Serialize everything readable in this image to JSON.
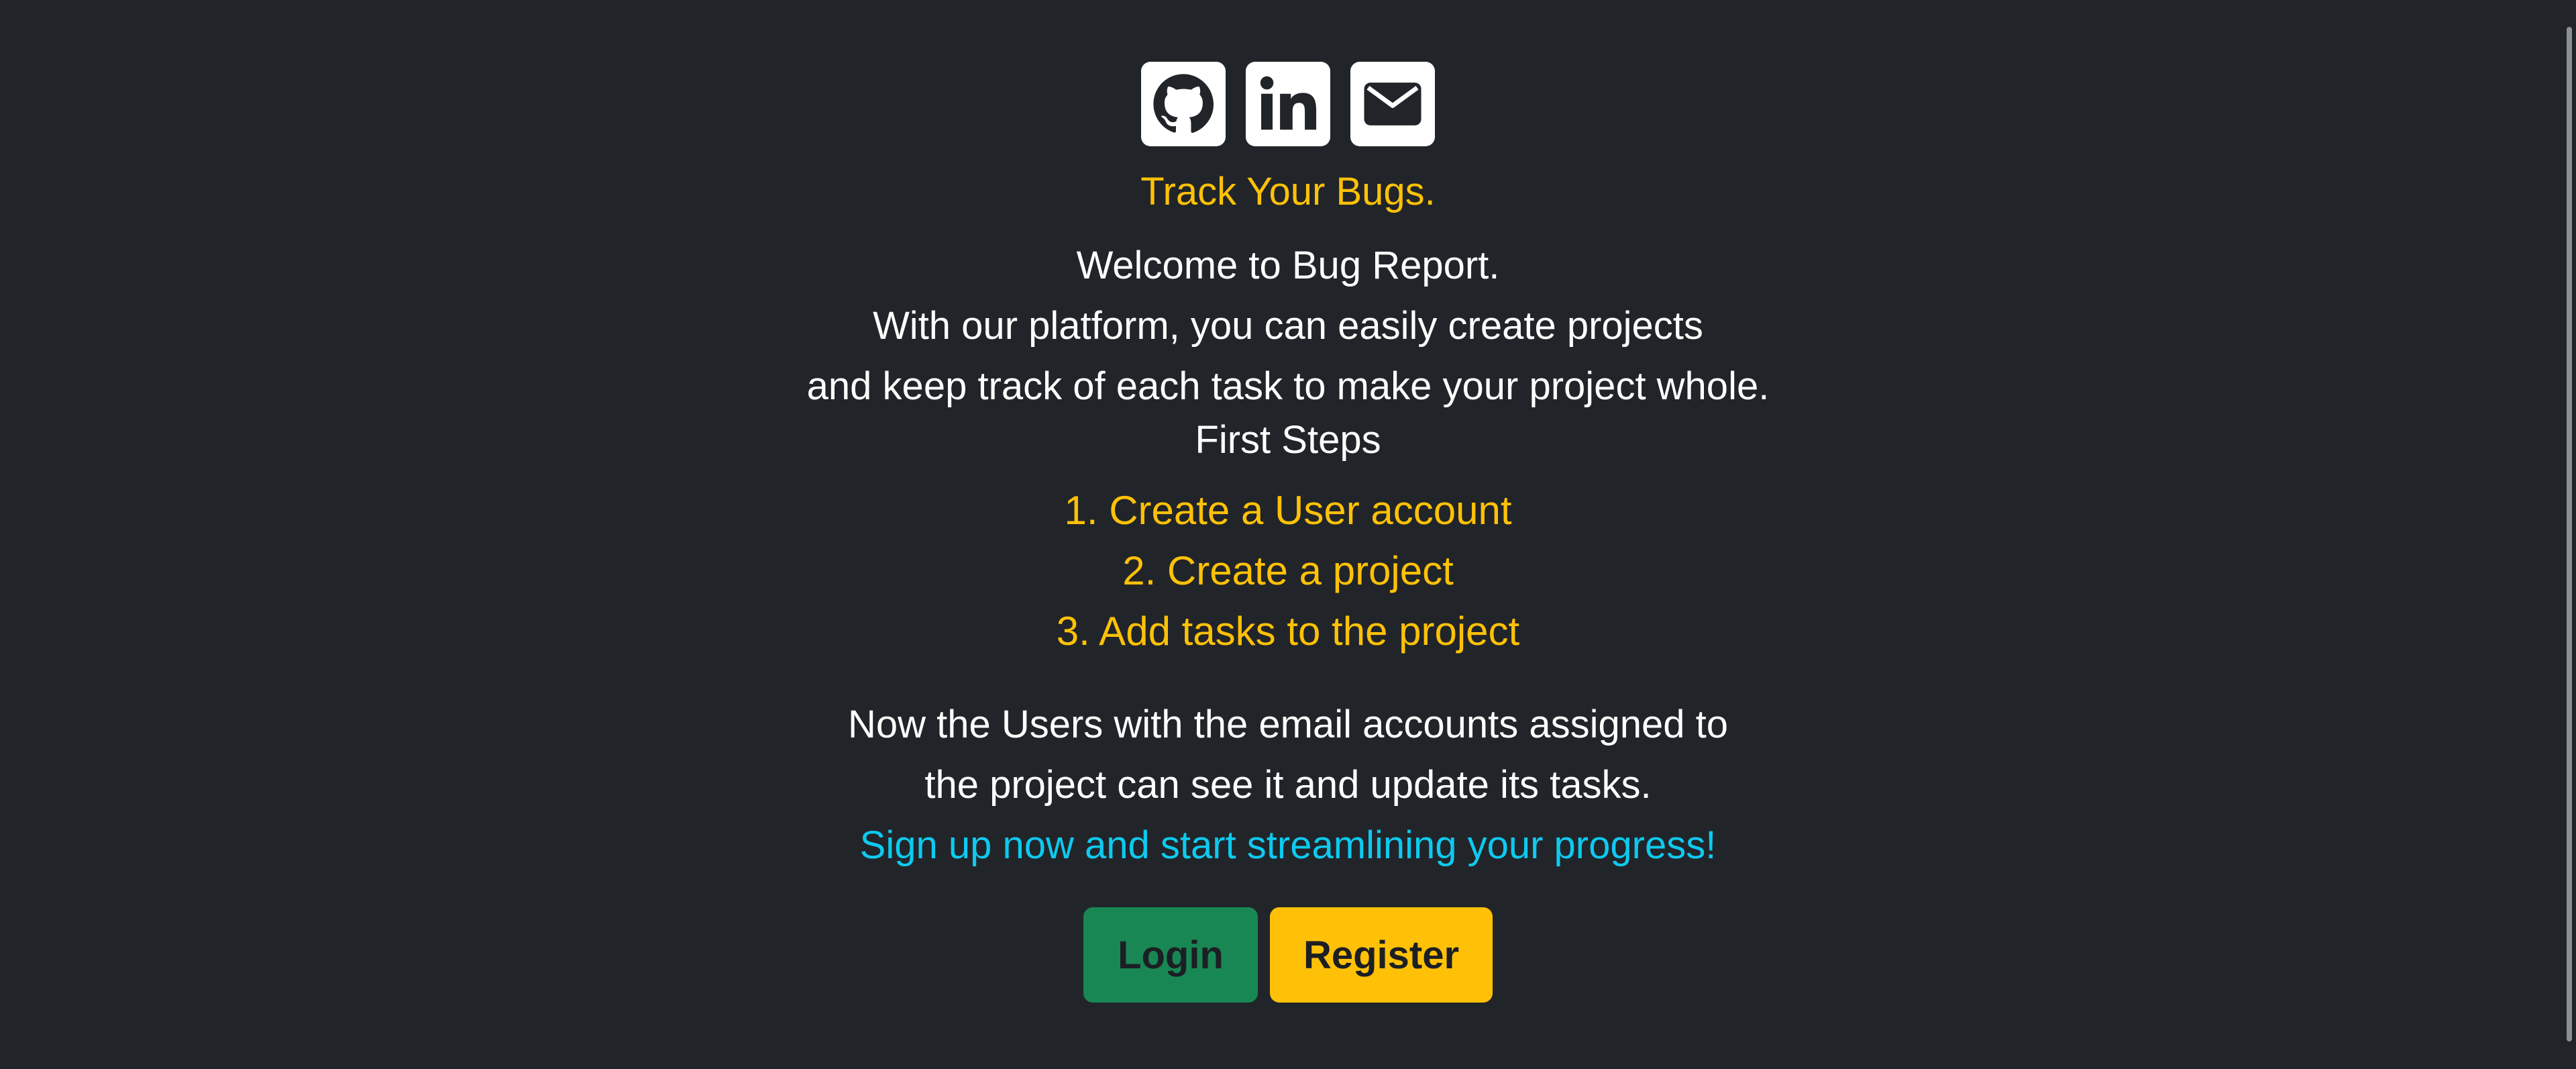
{
  "socials": [
    {
      "name": "github-icon",
      "label": "GitHub"
    },
    {
      "name": "linkedin-icon",
      "label": "LinkedIn"
    },
    {
      "name": "email-icon",
      "label": "Email"
    }
  ],
  "hero": {
    "tagline": "Track Your Bugs.",
    "intro_lines": [
      "Welcome to Bug Report.",
      "With our platform, you can easily create projects",
      "and keep track of each task to make your project whole."
    ]
  },
  "first_steps": {
    "title": "First Steps",
    "items": [
      "1. Create a User account",
      "2. Create a project",
      "3. Add tasks to the project"
    ]
  },
  "outro": {
    "lines": [
      "Now the Users with the email accounts assigned to",
      "the project can see it and update its tasks."
    ],
    "cta": "Sign up now and start streamlining your progress!"
  },
  "actions": {
    "login_label": "Login",
    "register_label": "Register"
  },
  "colors": {
    "background": "#212529",
    "accent_yellow": "#ffc107",
    "accent_green": "#198754",
    "accent_cyan": "#0dcaf0",
    "text_white": "#ffffff"
  }
}
